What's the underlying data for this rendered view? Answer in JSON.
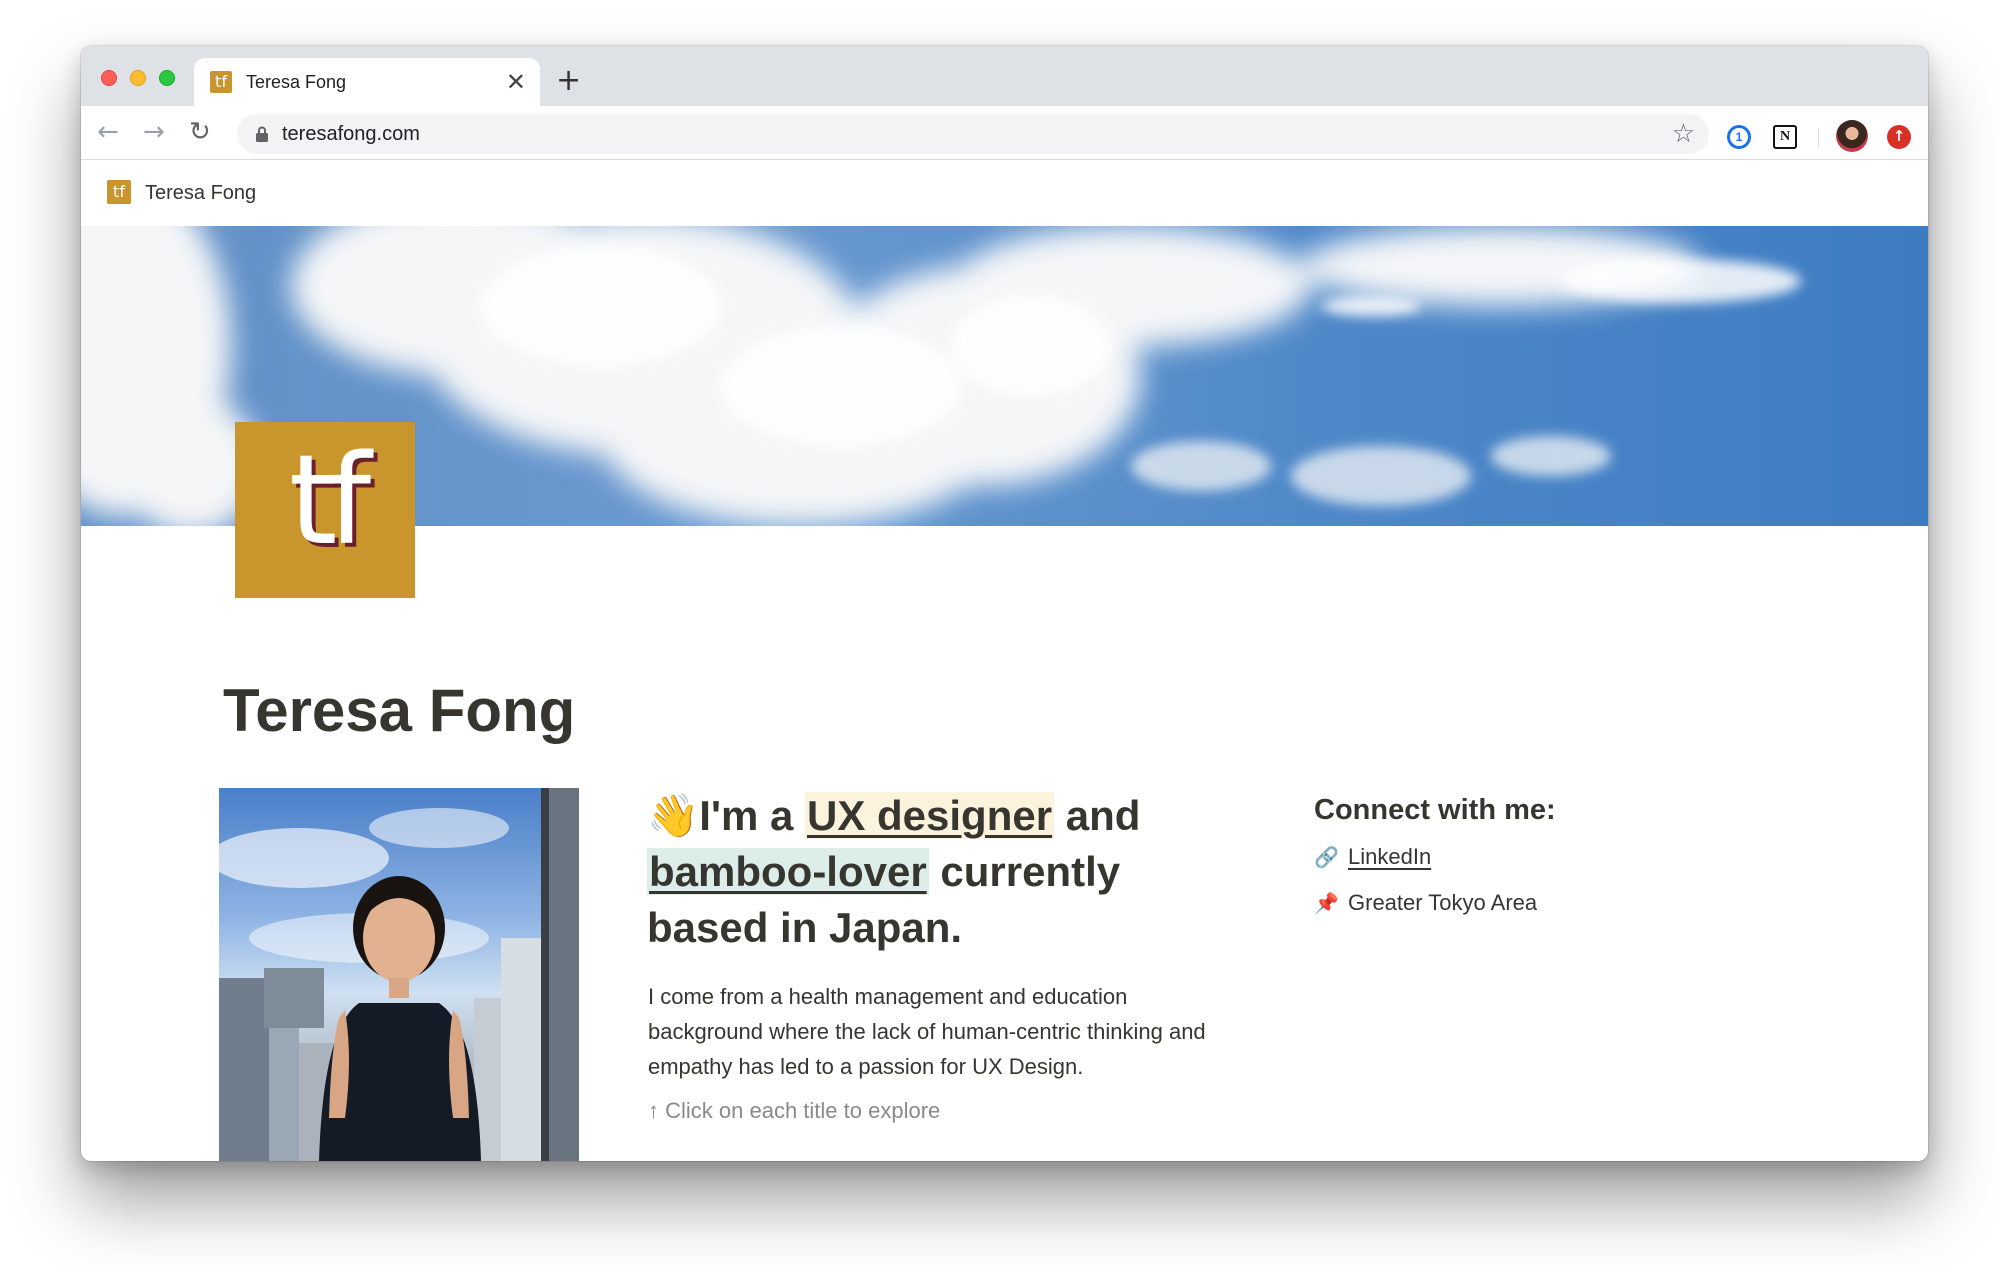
{
  "browser": {
    "tab": {
      "title": "Teresa Fong",
      "favicon_text": "tf",
      "close_glyph": "✕"
    },
    "new_tab_glyph": "+",
    "toolbar": {
      "back_glyph": "←",
      "forward_glyph": "→",
      "reload_glyph": "↻",
      "url": "teresafong.com",
      "bookmark_glyph": "☆",
      "extensions": [
        {
          "name": "1password-icon",
          "label": "1"
        },
        {
          "name": "notion-icon",
          "label": "N"
        }
      ],
      "update_glyph": "↑"
    }
  },
  "notion_bar": {
    "favicon_text": "tf",
    "title": "Teresa Fong"
  },
  "page": {
    "icon_text": "tf",
    "title": "Teresa Fong",
    "headline": {
      "emoji": "👋",
      "part1": "I'm a ",
      "highlight1": "UX designer",
      "part2": " and ",
      "highlight2": "bamboo-lover",
      "part3": " currently based in Japan."
    },
    "intro": "I come from a health management and education background where the lack of human-centric thinking and empathy has led to a passion for UX Design.",
    "hint": "↑ Click on each title to explore",
    "connect": {
      "heading": "Connect with me:",
      "items": [
        {
          "icon": "🔗",
          "label": "LinkedIn"
        },
        {
          "icon": "📌",
          "label": "Greater Tokyo Area"
        }
      ]
    }
  },
  "colors": {
    "brand_gold": "#c9962d",
    "text": "#37352f",
    "ux_highlight": "#fbf3db",
    "bamboo_highlight": "#ddedea",
    "muted": "#8b8a86"
  }
}
